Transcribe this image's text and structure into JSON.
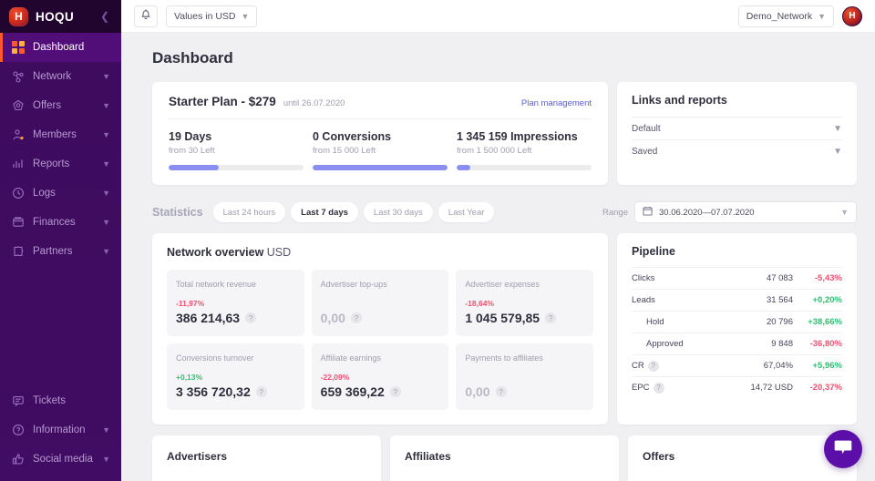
{
  "sidebar": {
    "brand": "HOQU",
    "logo_letter": "H",
    "collapse_icon": "chevron-left-icon",
    "items": [
      {
        "label": "Dashboard",
        "icon": "grid-icon",
        "active": true,
        "chevron": false
      },
      {
        "label": "Network",
        "icon": "network-icon",
        "active": false,
        "chevron": true
      },
      {
        "label": "Offers",
        "icon": "offers-icon",
        "active": false,
        "chevron": true
      },
      {
        "label": "Members",
        "icon": "member-icon",
        "active": false,
        "chevron": true
      },
      {
        "label": "Reports",
        "icon": "bars-icon",
        "active": false,
        "chevron": true
      },
      {
        "label": "Logs",
        "icon": "clock-icon",
        "active": false,
        "chevron": true
      },
      {
        "label": "Finances",
        "icon": "wallet-icon",
        "active": false,
        "chevron": true
      },
      {
        "label": "Partners",
        "icon": "puzzle-icon",
        "active": false,
        "chevron": true
      }
    ],
    "bottom_items": [
      {
        "label": "Tickets",
        "icon": "chat-icon",
        "chevron": false
      },
      {
        "label": "Information",
        "icon": "help-icon",
        "chevron": true
      },
      {
        "label": "Social media",
        "icon": "thumb-icon",
        "chevron": true
      }
    ]
  },
  "topbar": {
    "bell_icon": "bell-icon",
    "currency_label": "Values in USD",
    "network_label": "Demo_Network",
    "avatar_letter": "H"
  },
  "page": {
    "title": "Dashboard"
  },
  "plan": {
    "title": "Starter Plan - $279",
    "until": "until 26.07.2020",
    "manage_link": "Plan management",
    "stats": [
      {
        "value": "19 Days",
        "sub": "from 30 Left",
        "percent": 37
      },
      {
        "value": "0 Conversions",
        "sub": "from 15 000 Left",
        "percent": 100
      },
      {
        "value": "1 345 159 Impressions",
        "sub": "from 1 500 000 Left",
        "percent": 10
      }
    ]
  },
  "links": {
    "title": "Links and reports",
    "rows": [
      {
        "label": "Default",
        "icon": "chevron-down-icon"
      },
      {
        "label": "Saved",
        "icon": "chevron-down-icon"
      }
    ]
  },
  "statistics": {
    "label": "Statistics",
    "chips": [
      {
        "label": "Last 24 hours",
        "active": false
      },
      {
        "label": "Last 7 days",
        "active": true
      },
      {
        "label": "Last 30 days",
        "active": false
      },
      {
        "label": "Last Year",
        "active": false
      }
    ],
    "range_label": "Range",
    "range_icon": "calendar-icon",
    "range_value": "30.06.2020—07.07.2020"
  },
  "overview": {
    "title": "Network overview",
    "currency": "USD",
    "cells": [
      {
        "name": "Total network revenue",
        "delta": "-11,97%",
        "delta_sign": "neg",
        "value": "386 214,63",
        "muted": false
      },
      {
        "name": "Advertiser top-ups",
        "delta": "",
        "delta_sign": "none",
        "value": "0,00",
        "muted": true
      },
      {
        "name": "Advertiser expenses",
        "delta": "-18,64%",
        "delta_sign": "neg",
        "value": "1 045 579,85",
        "muted": false
      },
      {
        "name": "Conversions turnover",
        "delta": "+0,13%",
        "delta_sign": "pos",
        "value": "3 356 720,32",
        "muted": false
      },
      {
        "name": "Affiliate earnings",
        "delta": "-22,09%",
        "delta_sign": "neg",
        "value": "659 369,22",
        "muted": false
      },
      {
        "name": "Payments to affiliates",
        "delta": "",
        "delta_sign": "none",
        "value": "0,00",
        "muted": true
      }
    ],
    "help_glyph": "?"
  },
  "pipeline": {
    "title": "Pipeline",
    "rows": [
      {
        "name": "Clicks",
        "value": "47 083",
        "pct": "-5,43%",
        "sign": "neg",
        "indent": false,
        "help": false
      },
      {
        "name": "Leads",
        "value": "31 564",
        "pct": "+0,20%",
        "sign": "pos",
        "indent": false,
        "help": false
      },
      {
        "name": "Hold",
        "value": "20 796",
        "pct": "+38,66%",
        "sign": "pos",
        "indent": true,
        "help": false
      },
      {
        "name": "Approved",
        "value": "9 848",
        "pct": "-36,80%",
        "sign": "neg",
        "indent": true,
        "help": false
      },
      {
        "name": "CR",
        "value": "67,04%",
        "pct": "+5,96%",
        "sign": "pos",
        "indent": false,
        "help": true
      },
      {
        "name": "EPC",
        "value": "14,72 USD",
        "pct": "-20,37%",
        "sign": "neg",
        "indent": false,
        "help": true
      }
    ]
  },
  "bottom_cards": [
    {
      "title": "Advertisers"
    },
    {
      "title": "Affiliates"
    },
    {
      "title": "Offers"
    }
  ],
  "chat": {
    "icon": "chat-bubble-icon"
  },
  "colors": {
    "sidebar_bg": "#3d0b5e",
    "sidebar_active": "#520e78",
    "accent_orange": "#ff5a2b",
    "progress": "#8a8ef0",
    "link": "#5b5bd6",
    "negative": "#f2506e",
    "positive": "#2fbf71",
    "chat_fab": "#5c0fa8",
    "page_bg": "#f0f0f3"
  }
}
